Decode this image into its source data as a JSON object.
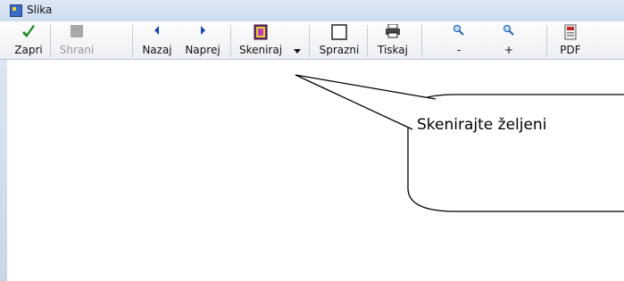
{
  "window": {
    "title": "Slika",
    "icon": "picture-app-icon"
  },
  "toolbar": {
    "buttons": [
      {
        "label": "Zapri",
        "icon": "checkmark-icon",
        "enabled": true
      },
      {
        "label": "Shrani",
        "icon": "save-icon",
        "enabled": false
      },
      {
        "label": "Nazaj",
        "icon": "arrow-left-icon",
        "enabled": true
      },
      {
        "label": "Naprej",
        "icon": "arrow-right-icon",
        "enabled": true
      },
      {
        "label": "Skeniraj",
        "icon": "scanner-icon",
        "enabled": true,
        "has_dropdown": true
      },
      {
        "label": "Sprazni",
        "icon": "empty-box-icon",
        "enabled": true
      },
      {
        "label": "Tiskaj",
        "icon": "printer-icon",
        "enabled": true
      },
      {
        "label": "-",
        "icon": "zoom-out-icon",
        "enabled": true
      },
      {
        "label": "+",
        "icon": "zoom-in-icon",
        "enabled": true
      },
      {
        "label": "PDF",
        "icon": "pdf-icon",
        "enabled": true
      }
    ]
  },
  "callout": {
    "text": "Skenirajte željeni"
  },
  "colors": {
    "check": "#1f8a1f",
    "arrow": "#1b46b8",
    "disabled": "#9a9a9a"
  }
}
